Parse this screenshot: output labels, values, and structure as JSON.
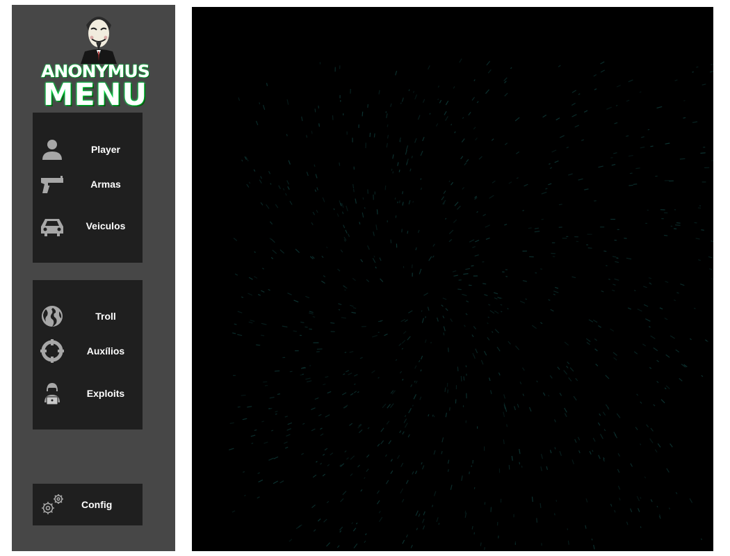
{
  "logo": {
    "title": "ANONYMUS",
    "subtitle": "MENU",
    "accent_color": "#00ff55"
  },
  "menu_primary": [
    {
      "label": "Player",
      "icon": "player-icon"
    },
    {
      "label": "Armas",
      "icon": "gun-icon"
    },
    {
      "label": "Veiculos",
      "icon": "car-icon"
    }
  ],
  "menu_secondary": [
    {
      "label": "Troll",
      "icon": "globe-icon"
    },
    {
      "label": "Auxílios",
      "icon": "crosshair-icon"
    },
    {
      "label": "Exploits",
      "icon": "hacker-icon"
    }
  ],
  "footer": {
    "label": "Config",
    "icon": "gears-icon"
  },
  "colors": {
    "sidebar_bg": "#474747",
    "panel_bg": "#1f1f1f",
    "viewport_bg": "#000000",
    "particle": "#0f3a38"
  }
}
